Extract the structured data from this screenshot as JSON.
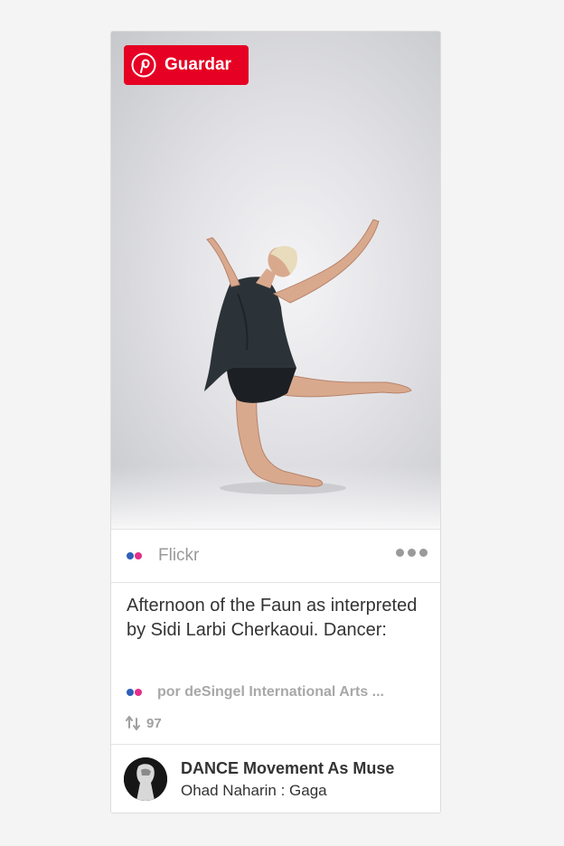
{
  "pin": {
    "save_button_label": "Guardar",
    "source_name": "Flickr",
    "description": "Afternoon of the Faun as interpreted by Sidi Larbi Cherkaoui. Dancer:",
    "attribution": "por deSingel International Arts ...",
    "repin_count": "97",
    "board": {
      "name": "DANCE Movement As Muse",
      "owner": "Ohad Naharin : Gaga"
    }
  },
  "colors": {
    "save_button": "#e60023",
    "flickr_blue": "#2f5fb8",
    "flickr_pink": "#e52f8a",
    "muted_text": "#9a9a9a",
    "body_text": "#333333"
  },
  "icons": {
    "save": "pinterest-logo-icon",
    "source": "flickr-icon",
    "more": "more-options-icon",
    "repin": "pin-count-icon"
  }
}
